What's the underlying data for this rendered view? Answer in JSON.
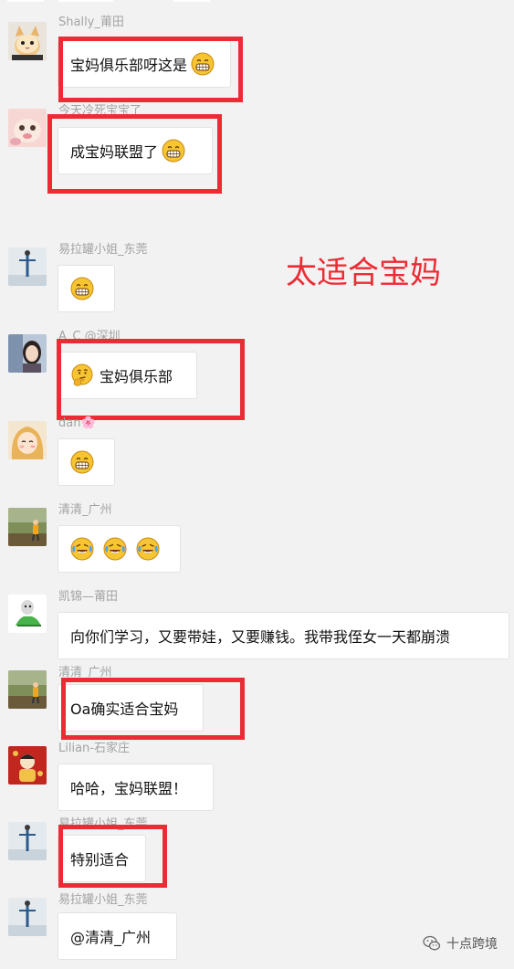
{
  "overlay_caption": "太适合宝妈",
  "watermark": {
    "text": "十点跨境",
    "icon": "wechat-logo-icon"
  },
  "colors": {
    "highlight": "#ec2b34",
    "background": "#f2f2f2",
    "bubble": "#ffffff",
    "nickname": "#a3a3a3"
  },
  "messages": [
    {
      "nickname": "Shally_莆田",
      "avatar": "cat-avatar",
      "text": "宝妈俱乐部呀这是",
      "emoji_after": [
        "grin-emoji"
      ],
      "highlighted": true
    },
    {
      "nickname": "今天冷死宝宝了",
      "avatar": "kitten-avatar",
      "text": "成宝妈联盟了",
      "emoji_after": [
        "grin-emoji"
      ],
      "highlighted": true
    },
    {
      "nickname": "易拉罐小姐_东莞",
      "avatar": "yoga-avatar",
      "text": "",
      "emoji_after": [
        "grin-emoji"
      ],
      "highlighted": false
    },
    {
      "nickname": "A_C @深圳",
      "avatar": "woman-avatar",
      "text": "宝妈俱乐部",
      "emoji_before": [
        "thinking-emoji"
      ],
      "highlighted": true
    },
    {
      "nickname": "dan🌸",
      "avatar": "anime-girl-avatar",
      "text": "",
      "emoji_after": [
        "grin-emoji"
      ],
      "highlighted": false
    },
    {
      "nickname": "清清_广州",
      "avatar": "child-avatar",
      "text": "",
      "emoji_after": [
        "crying-laughing-emoji",
        "crying-laughing-emoji",
        "crying-laughing-emoji"
      ],
      "highlighted": false
    },
    {
      "nickname": "凯锦—莆田",
      "avatar": "cartoon-avatar",
      "text": "向你们学习，又要带娃，又要赚钱。我带我侄女一天都崩溃",
      "highlighted": false
    },
    {
      "nickname": "清清_广州",
      "avatar": "child-avatar",
      "text": "Oa确实适合宝妈",
      "highlighted": true
    },
    {
      "nickname": "Lilian-石家庄",
      "avatar": "festive-avatar",
      "text": "哈哈，宝妈联盟！",
      "highlighted": false
    },
    {
      "nickname": "易拉罐小姐_东莞",
      "avatar": "yoga-avatar",
      "text": "特别适合",
      "highlighted": true
    },
    {
      "nickname": "易拉罐小姐_东莞",
      "avatar": "yoga-avatar",
      "text": "@清清_广州",
      "highlighted": false
    }
  ]
}
